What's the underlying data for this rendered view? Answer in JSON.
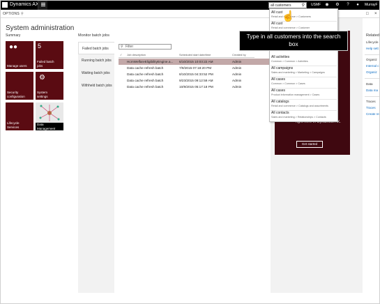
{
  "header": {
    "app_title": "Dynamics AX",
    "search_value": "all customers",
    "company": "USMF",
    "user": "MurrayF",
    "icons": [
      "bell-icon",
      "gear-icon",
      "help-icon",
      "refresh-icon",
      "avatar"
    ]
  },
  "options_bar": {
    "options_label": "OPTIONS"
  },
  "workspace": {
    "title": "System administration",
    "summary_label": "Summary",
    "tiles": [
      {
        "label": "Manage users",
        "icon": "users-icon"
      },
      {
        "label": "Failed batch\njobs",
        "count": "5"
      },
      {
        "label": "Security\nconfiguration",
        "icon": "lock-icon"
      },
      {
        "label": "System\nsettings",
        "icon": "gear-icon"
      },
      {
        "label": "Lifecycle\nServices",
        "icon": "none"
      },
      {
        "label": "Data\nManagement",
        "icon": "data-image"
      }
    ]
  },
  "monitor": {
    "title": "Monitor batch jobs",
    "tabs": [
      "Failed batch jobs",
      "Running batch jobs",
      "Waiting batch jobs",
      "Withheld batch jobs"
    ],
    "filter_placeholder": "Filter",
    "columns": [
      "Job description",
      "Scheduled start date/time",
      "Created by"
    ],
    "rows": [
      {
        "desc": "HcmWelfareEligibilityEngine.a...",
        "date": "6/10/2015 10:03:22 AM",
        "by": "Admin",
        "selected": true
      },
      {
        "desc": "Data cache refresh batch",
        "date": "7/9/2015 07:18:20 PM",
        "by": "Admin"
      },
      {
        "desc": "Data cache refresh batch",
        "date": "8/10/2015 04:33:52 PM",
        "by": "Admin"
      },
      {
        "desc": "Data cache refresh batch",
        "date": "9/23/2015 09:12:59 AM",
        "by": "Admin"
      },
      {
        "desc": "Data cache refresh batch",
        "date": "10/9/2015 05:17:18 PM",
        "by": "Admin"
      }
    ]
  },
  "promo": {
    "text": "right here in Dynamics AX.",
    "button": "Get started"
  },
  "related": {
    "title": "Related",
    "items": [
      {
        "text": "Lifecycle",
        "kind": "h"
      },
      {
        "text": "Help sett",
        "kind": "l"
      },
      {
        "text": "Organiz",
        "kind": "h"
      },
      {
        "text": "Internal c",
        "kind": "l"
      },
      {
        "text": "Organiz",
        "kind": "l"
      },
      {
        "text": "Data",
        "kind": "h"
      },
      {
        "text": "Data ma",
        "kind": "l"
      },
      {
        "text": "Traces",
        "kind": "h"
      },
      {
        "text": "Traces",
        "kind": "l"
      },
      {
        "text": "Create re",
        "kind": "l"
      }
    ]
  },
  "search_results": [
    {
      "title": "All cust",
      "path": "Retail and commerce > Customers"
    },
    {
      "title": "All cust",
      "path": "Retail and commerce > Customer"
    },
    {
      "title": "All activities",
      "path": "Common > Common > Activities"
    },
    {
      "title": "All campaigns",
      "path": "Sales and marketing > Marketing > Campaigns"
    },
    {
      "title": "All cases",
      "path": "Common > Common > Cases"
    },
    {
      "title": "All cases",
      "path": "Product information management > Cases"
    },
    {
      "title": "All catalogs",
      "path": "Retail and commerce > Catalogs and assortments"
    },
    {
      "title": "All contacts",
      "path": "Sales and marketing > Relationships > Contacts"
    }
  ],
  "tooltip": {
    "text": "Type in all customers into the search box"
  },
  "colors": {
    "brand": "#5a0b12",
    "topbar": "#000000",
    "selected_row": "#c2a8a8",
    "link": "#0a6bc2"
  }
}
